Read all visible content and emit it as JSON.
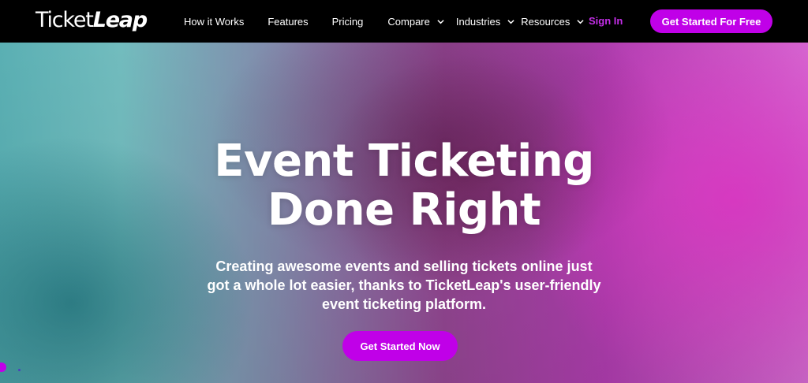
{
  "brand": {
    "logo_part1": "Ticket",
    "logo_part2": "Leap",
    "accent_color": "#c000e8"
  },
  "nav": {
    "items": [
      {
        "label": "How it Works",
        "has_dropdown": false
      },
      {
        "label": "Features",
        "has_dropdown": false
      },
      {
        "label": "Pricing",
        "has_dropdown": false
      },
      {
        "label": "Compare",
        "has_dropdown": true
      },
      {
        "label": "Industries",
        "has_dropdown": true
      },
      {
        "label": "Resources",
        "has_dropdown": true
      }
    ],
    "sign_in": "Sign In",
    "cta": "Get Started For Free"
  },
  "hero": {
    "title_line1": "Event Ticketing",
    "title_line2": "Done Right",
    "subtitle": "Creating awesome events and selling tickets online just got a whole lot easier, thanks to TicketLeap's user-friendly event ticketing platform.",
    "cta": "Get Started Now"
  }
}
